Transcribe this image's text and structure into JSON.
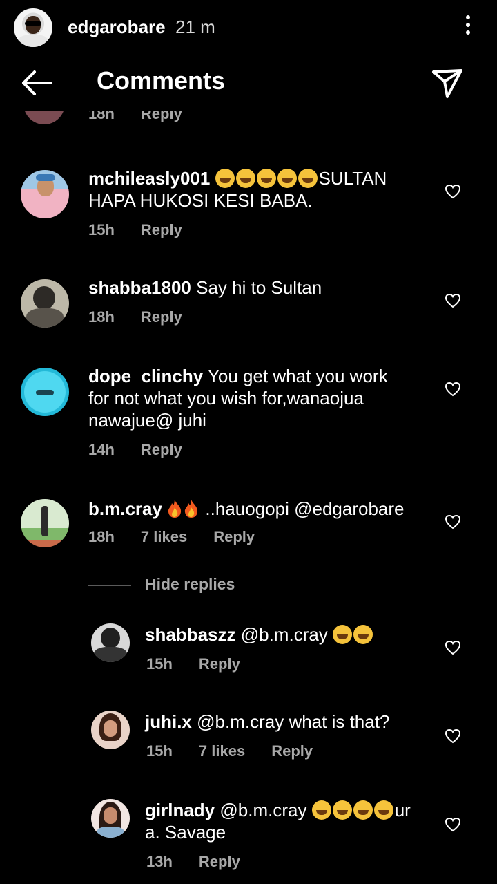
{
  "story": {
    "username": "edgarobare",
    "time": "21 m"
  },
  "header": {
    "title": "Comments"
  },
  "partial_comment": {
    "time": "18h",
    "reply": "Reply"
  },
  "comments": [
    {
      "username": "mchileasly001",
      "text_after_emoji": "SULTAN",
      "text_line2": "HAPA HUKOSI KESI BABA.",
      "time": "15h",
      "reply": "Reply"
    },
    {
      "username": "shabba1800",
      "text": "Say hi to Sultan",
      "time": "18h",
      "reply": "Reply"
    },
    {
      "username": "dope_clinchy",
      "text_line1": "You get what you work",
      "text_line2": "for not what you wish for,wanaojua",
      "text_line3": "nawajue@ juhi",
      "time": "14h",
      "reply": "Reply"
    },
    {
      "username": "b.m.cray",
      "text_after_emoji": "..hauogopi @edgarobare",
      "time": "18h",
      "likes": "7 likes",
      "reply": "Reply"
    }
  ],
  "hide_replies": "Hide replies",
  "replies": [
    {
      "username": "shabbaszz",
      "text": "@b.m.cray",
      "time": "15h",
      "reply": "Reply"
    },
    {
      "username": "juhi.x",
      "text": "@b.m.cray what is that?",
      "time": "15h",
      "likes": "7 likes",
      "reply": "Reply"
    },
    {
      "username": "girlnady",
      "text": "@b.m.cray",
      "text_after_emoji": "ur",
      "text_line2": "a. Savage",
      "time": "13h",
      "reply": "Reply"
    }
  ],
  "icons": {
    "back": "back-arrow-icon",
    "send": "send-icon",
    "more": "more-vertical-icon",
    "like": "heart-icon"
  }
}
